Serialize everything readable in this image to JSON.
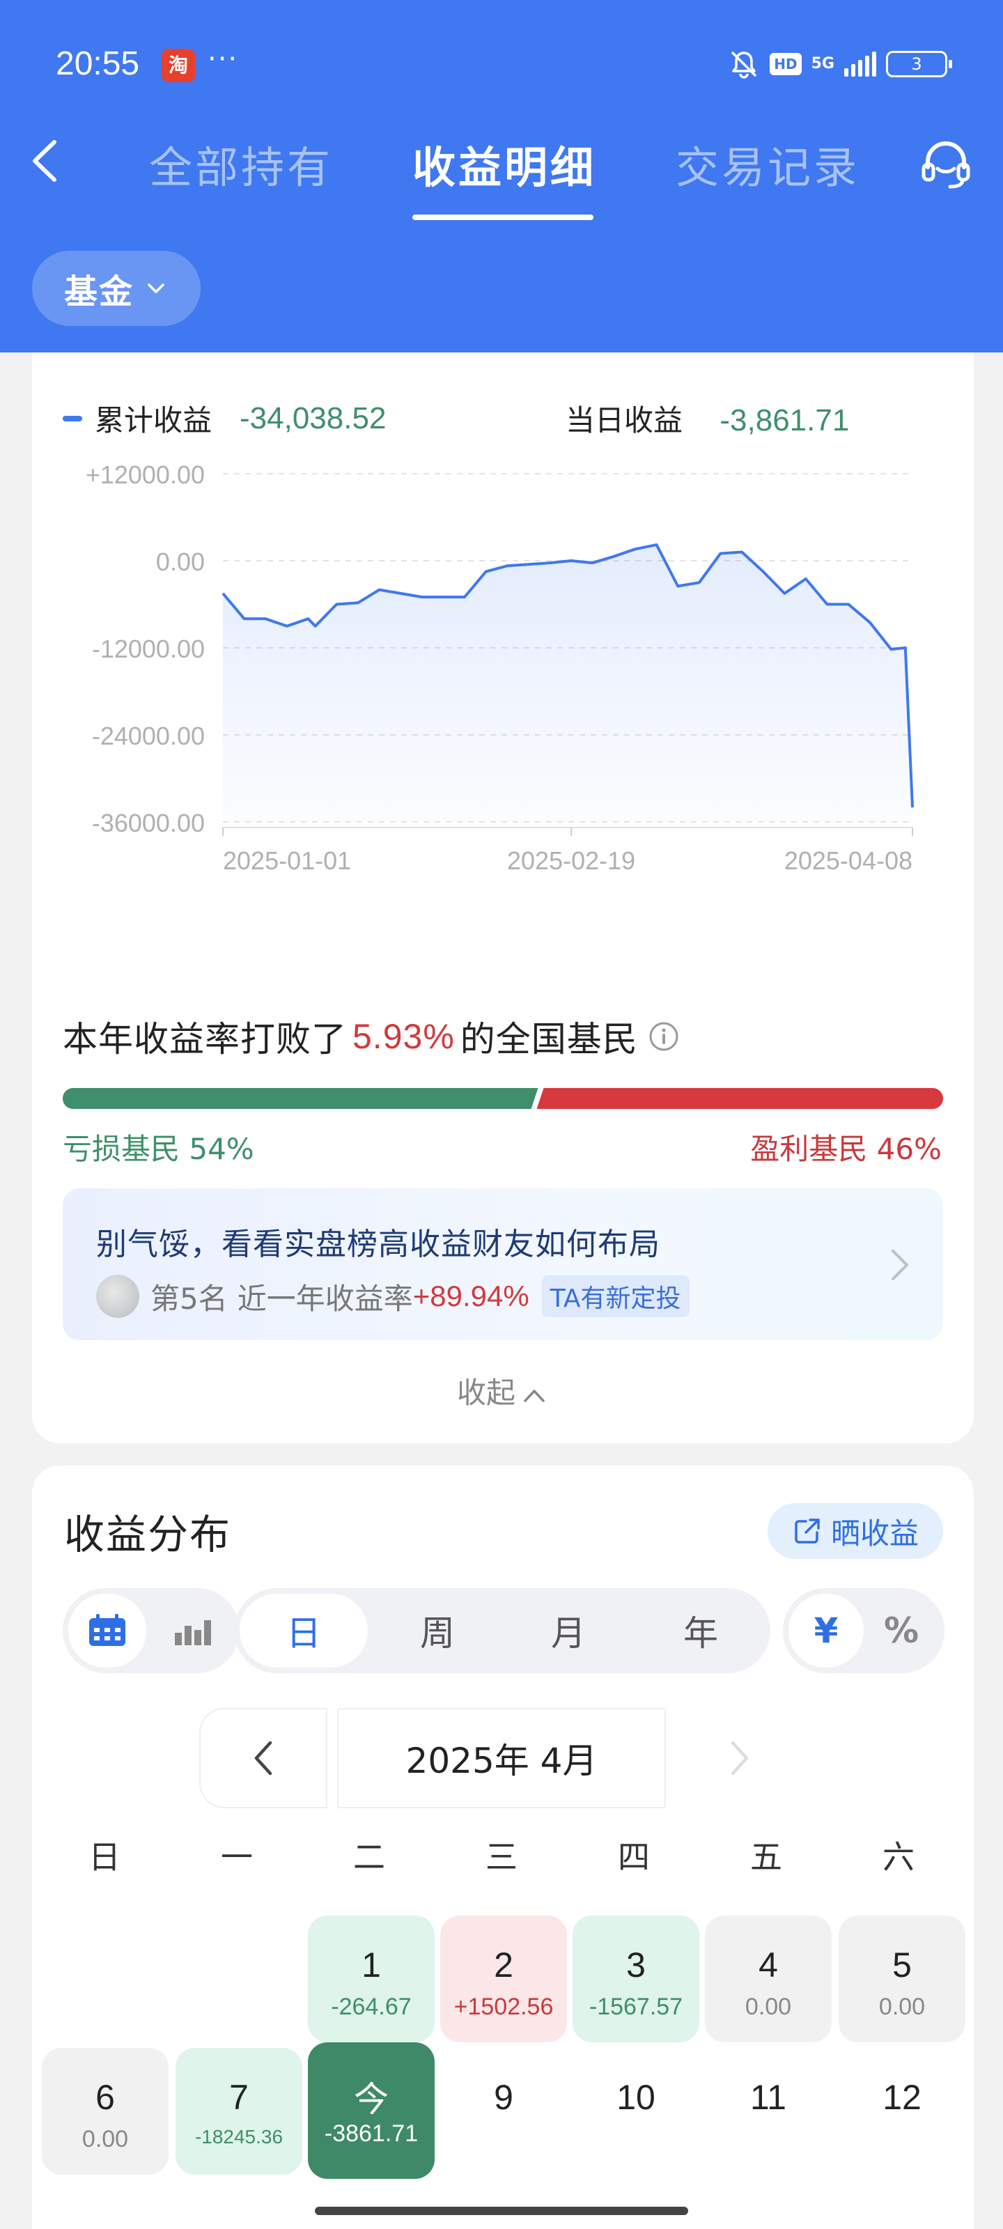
{
  "status_bar": {
    "time": "20:55",
    "app_badge": "淘",
    "dots": "···",
    "hd": "HD",
    "network": "5G",
    "battery": "3"
  },
  "nav": {
    "tabs": [
      {
        "label": "全部持有",
        "active": false
      },
      {
        "label": "收益明细",
        "active": true
      },
      {
        "label": "交易记录",
        "active": false
      }
    ],
    "filter": "基金"
  },
  "summary": {
    "cumulative_label": "累计收益",
    "cumulative_value": "-34,038.52",
    "daily_label": "当日收益",
    "daily_value": "-3,861.71"
  },
  "chart_data": {
    "type": "area",
    "yticks": [
      "+12000.00",
      "0.00",
      "-12000.00",
      "-24000.00",
      "-36000.00"
    ],
    "xticks": [
      "2025-01-01",
      "2025-02-19",
      "2025-04-08"
    ],
    "ylim": [
      -36000,
      12000
    ],
    "xlim": [
      "2025-01-01",
      "2025-04-08"
    ],
    "grid": true,
    "series": [
      {
        "x": [
          "2025-01-01",
          "2025-01-04",
          "2025-01-07",
          "2025-01-10",
          "2025-01-13",
          "2025-01-14",
          "2025-01-17",
          "2025-01-20",
          "2025-01-23",
          "2025-01-26",
          "2025-01-29",
          "2025-02-01",
          "2025-02-04",
          "2025-02-07",
          "2025-02-10",
          "2025-02-13",
          "2025-02-16",
          "2025-02-19",
          "2025-02-22",
          "2025-02-25",
          "2025-02-28",
          "2025-03-03",
          "2025-03-06",
          "2025-03-09",
          "2025-03-12",
          "2025-03-15",
          "2025-03-18",
          "2025-03-21",
          "2025-03-24",
          "2025-03-27",
          "2025-03-30",
          "2025-04-02",
          "2025-04-05",
          "2025-04-07",
          "2025-04-08"
        ],
        "y": [
          -4500,
          -8000,
          -8000,
          -9000,
          -8000,
          -9000,
          -6000,
          -5800,
          -4000,
          -4500,
          -5000,
          -5000,
          -5000,
          -1500,
          -700,
          -500,
          -300,
          0,
          -300,
          600,
          1600,
          2200,
          -3500,
          -3000,
          1000,
          1200,
          -1500,
          -4500,
          -2500,
          -6000,
          -6000,
          -8500,
          -12200,
          -12000,
          -34000
        ]
      }
    ]
  },
  "beat": {
    "prefix": "本年收益率打败了",
    "percent": "5.93%",
    "suffix": "的全国基民"
  },
  "ratio": {
    "loss_label": "亏损基民 54%",
    "profit_label": "盈利基民 46%",
    "loss_fraction": 0.54,
    "loss_color": "#3e8f6a",
    "profit_color": "#d8393e"
  },
  "promo": {
    "title": "别气馁，看看实盘榜高收益财友如何布局",
    "rank": "第5名",
    "rate_label": "近一年收益率",
    "rate_value": "+89.94%",
    "tag": "TA有新定投"
  },
  "collapse_label": "收起",
  "distribution": {
    "title": "收益分布",
    "share_label": "晒收益",
    "periods": [
      {
        "label": "日",
        "active": true
      },
      {
        "label": "周",
        "active": false
      },
      {
        "label": "月",
        "active": false
      },
      {
        "label": "年",
        "active": false
      }
    ],
    "units": [
      {
        "label": "¥",
        "active": true
      },
      {
        "label": "%",
        "active": false
      }
    ],
    "month_label": "2025年 4月",
    "weekdays": [
      "日",
      "一",
      "二",
      "三",
      "四",
      "五",
      "六"
    ],
    "days": [
      {
        "day": "1",
        "value": "-264.67",
        "tone": "green"
      },
      {
        "day": "2",
        "value": "+1502.56",
        "tone": "red"
      },
      {
        "day": "3",
        "value": "-1567.57",
        "tone": "green"
      },
      {
        "day": "4",
        "value": "0.00",
        "tone": "gray"
      },
      {
        "day": "5",
        "value": "0.00",
        "tone": "gray"
      },
      {
        "day": "6",
        "value": "0.00",
        "tone": "gray"
      },
      {
        "day": "7",
        "value": "-18245.36",
        "tone": "green"
      },
      {
        "day": "今",
        "value": "-3861.71",
        "tone": "today"
      },
      {
        "day": "9",
        "value": "",
        "tone": "plain"
      },
      {
        "day": "10",
        "value": "",
        "tone": "plain"
      },
      {
        "day": "11",
        "value": "",
        "tone": "plain"
      },
      {
        "day": "12",
        "value": "",
        "tone": "plain"
      }
    ]
  }
}
